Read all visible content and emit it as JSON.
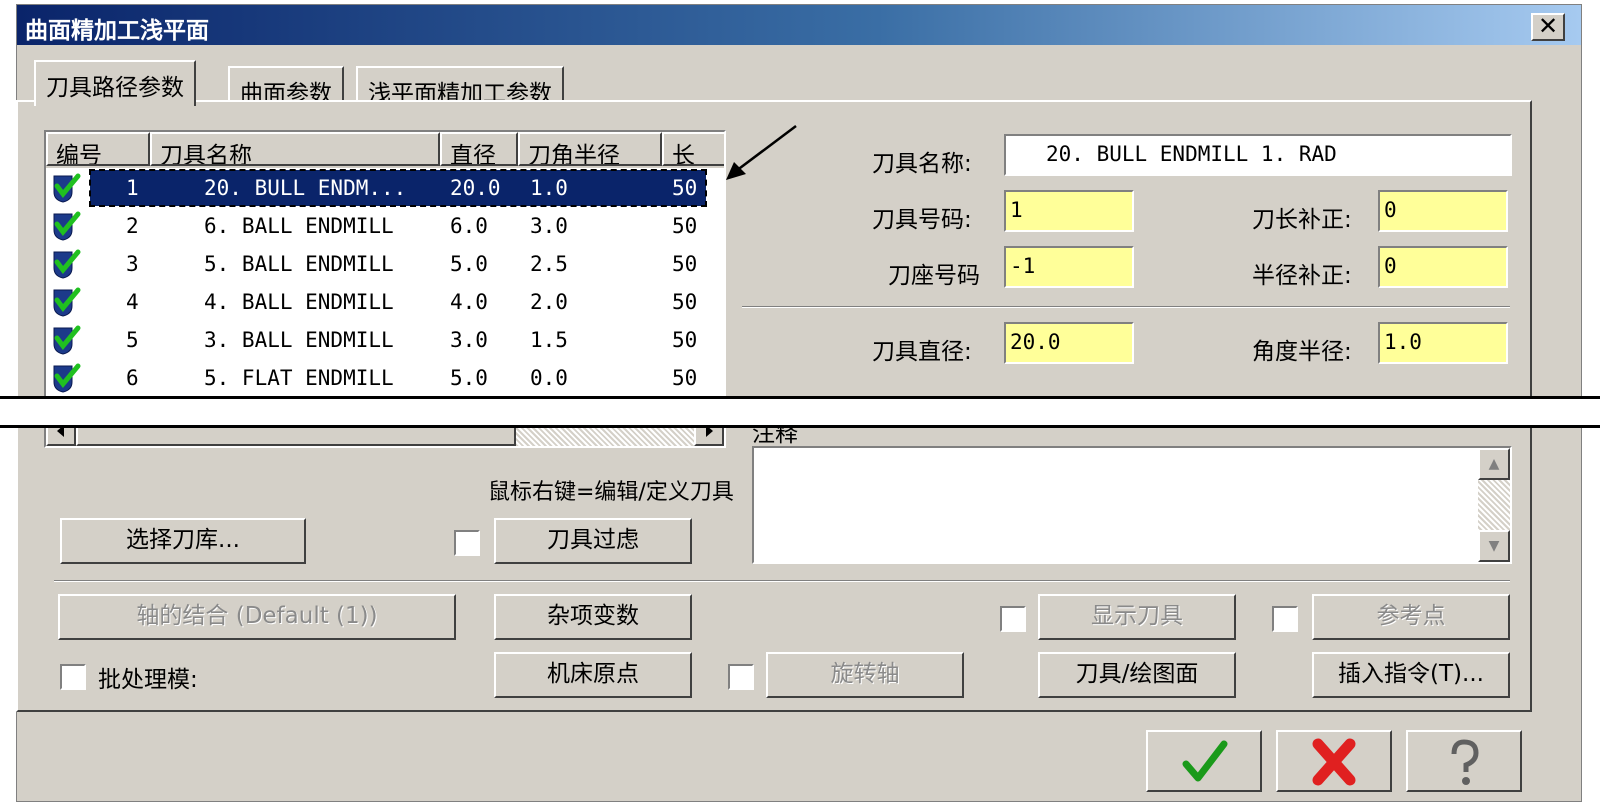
{
  "window": {
    "title": "曲面精加工浅平面",
    "close_glyph": "✕"
  },
  "tabs": [
    "刀具路径参数",
    "曲面参数",
    "浅平面精加工参数"
  ],
  "tool_list": {
    "columns": [
      "编号",
      "刀具名称",
      "直径",
      "刀角半径",
      "长"
    ],
    "rows": [
      {
        "num": "1",
        "name": "20. BULL ENDM...",
        "dia": "20.0",
        "rad": "1.0",
        "len": "50",
        "selected": true
      },
      {
        "num": "2",
        "name": "6. BALL ENDMILL",
        "dia": "6.0",
        "rad": "3.0",
        "len": "50"
      },
      {
        "num": "3",
        "name": "5. BALL ENDMILL",
        "dia": "5.0",
        "rad": "2.5",
        "len": "50"
      },
      {
        "num": "4",
        "name": "4. BALL ENDMILL",
        "dia": "4.0",
        "rad": "2.0",
        "len": "50"
      },
      {
        "num": "5",
        "name": "3. BALL ENDMILL",
        "dia": "3.0",
        "rad": "1.5",
        "len": "50"
      },
      {
        "num": "6",
        "name": "5. FLAT ENDMILL",
        "dia": "5.0",
        "rad": "0.0",
        "len": "50"
      }
    ],
    "check_icon": "shield-check-icon"
  },
  "tool_params": {
    "name_label": "刀具名称:",
    "name_value": "20. BULL ENDMILL 1. RAD",
    "number_label": "刀具号码:",
    "number_value": "1",
    "length_comp_label": "刀长补正:",
    "length_comp_value": "0",
    "holder_label": "刀座号码",
    "holder_value": "-1",
    "radius_comp_label": "半径补正:",
    "radius_comp_value": "0",
    "diameter_label": "刀具直径:",
    "diameter_value": "20.0",
    "corner_radius_label": "角度半径:",
    "corner_radius_value": "1.0"
  },
  "notes_label": "注释",
  "hint_text": "鼠标右键=编辑/定义刀具",
  "buttons": {
    "select_library": "选择刀库...",
    "tool_filter": "刀具过虑",
    "axis_combo": "轴的结合 (Default (1))",
    "misc_vars": "杂项变数",
    "show_tool": "显示刀具",
    "ref_point": "参考点",
    "batch_label": "批处理模:",
    "machine_origin": "机床原点",
    "rotary_axis": "旋转轴",
    "tool_plane": "刀具/绘图面",
    "insert_cmd": "插入指令(T)..."
  },
  "colors": {
    "title_start": "#0a246a",
    "field_yellow": "#ffff99",
    "selection": "#0a246a"
  }
}
